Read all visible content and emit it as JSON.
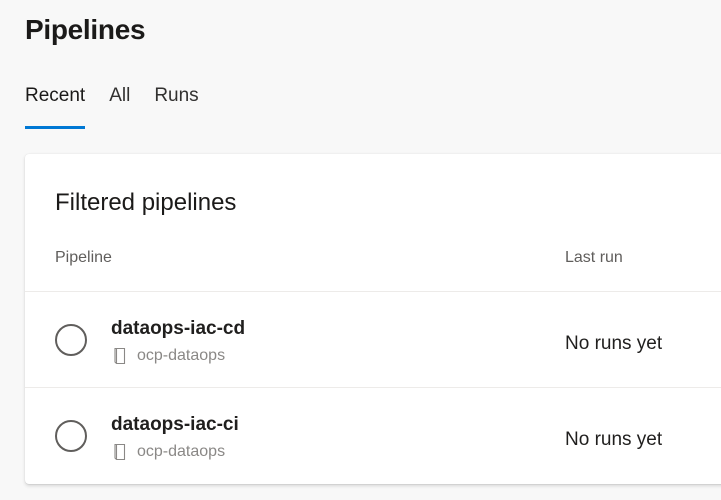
{
  "page": {
    "title": "Pipelines"
  },
  "tabs": [
    {
      "label": "Recent",
      "active": true
    },
    {
      "label": "All",
      "active": false
    },
    {
      "label": "Runs",
      "active": false
    }
  ],
  "card": {
    "title": "Filtered pipelines",
    "columns": {
      "pipeline": "Pipeline",
      "last_run": "Last run"
    },
    "rows": [
      {
        "name": "dataops-iac-cd",
        "repo": "ocp-dataops",
        "last_run": "No runs yet"
      },
      {
        "name": "dataops-iac-ci",
        "repo": "ocp-dataops",
        "last_run": "No runs yet"
      }
    ]
  },
  "colors": {
    "accent": "#0078d4",
    "background": "#f8f8f8",
    "card": "#ffffff"
  },
  "icons": {
    "status": "circle-status-icon",
    "repo": "repo-icon"
  }
}
